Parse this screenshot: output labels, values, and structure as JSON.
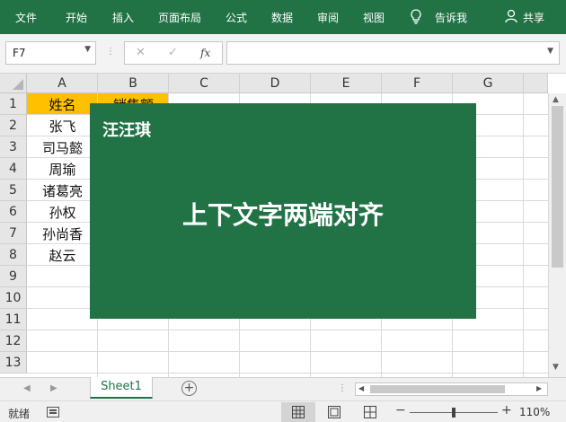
{
  "ribbon": {
    "tabs": [
      "文件",
      "开始",
      "插入",
      "页面布局",
      "公式",
      "数据",
      "审阅",
      "视图"
    ],
    "tell_me": "告诉我",
    "share": "共享"
  },
  "formula_bar": {
    "name_box": "F7",
    "fx": "fx",
    "cancel": "✕",
    "enter": "✓",
    "content": ""
  },
  "grid": {
    "columns": [
      "A",
      "B",
      "C",
      "D",
      "E",
      "F",
      "G"
    ],
    "rows": [
      "1",
      "2",
      "3",
      "4",
      "5",
      "6",
      "7",
      "8",
      "9",
      "10",
      "11",
      "12",
      "13"
    ],
    "header_cells": {
      "a1": "姓名",
      "b1": "销售额"
    },
    "names": [
      "张飞",
      "司马懿",
      "周瑜",
      "诸葛亮",
      "孙权",
      "孙尚香",
      "赵云"
    ]
  },
  "overlay": {
    "author": "汪汪琪",
    "title": "上下文字两端对齐",
    "color": "#217346"
  },
  "sheets": {
    "active": "Sheet1"
  },
  "status": {
    "ready": "就绪",
    "zoom": "110%"
  },
  "colors": {
    "accent": "#217346",
    "header_fill": "#ffc000"
  }
}
